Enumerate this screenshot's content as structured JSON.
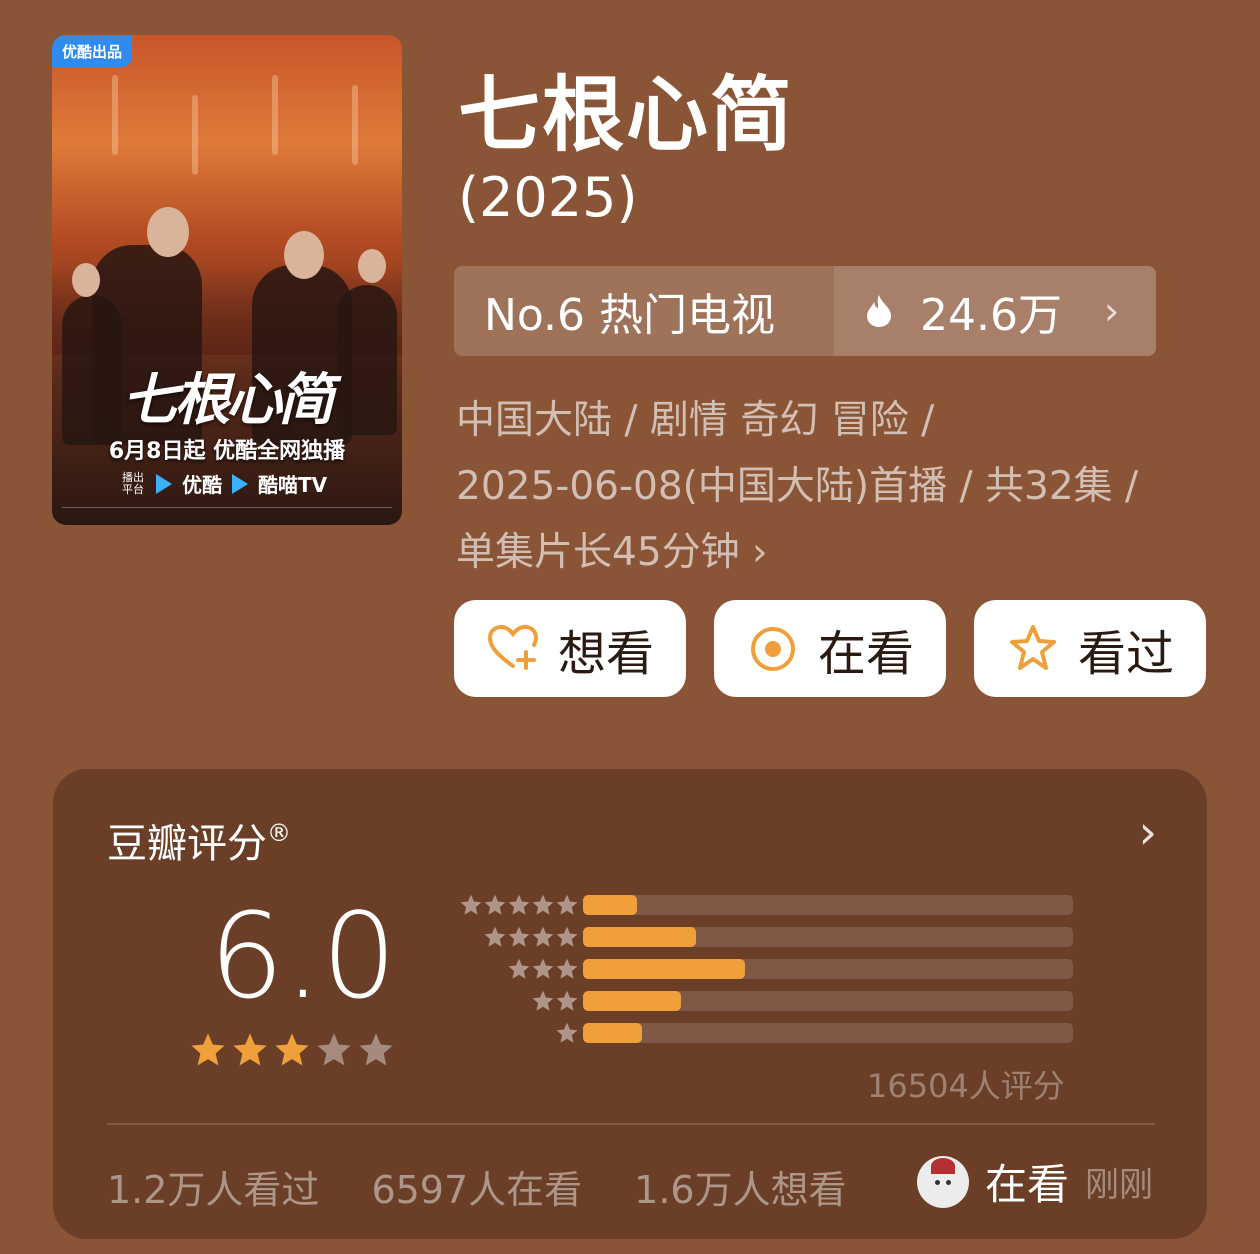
{
  "poster": {
    "badge": "优酷出品",
    "calligraphy": "七根心简",
    "release_line": "6月8日起 优酷全网独播",
    "platform_label": "播出平台",
    "platform_1": "优酷",
    "platform_2": "酷喵TV"
  },
  "title": "七根心简",
  "year": "(2025)",
  "rank": {
    "label": "No.6 热门电视",
    "heat": "24.6万",
    "chevron": "›"
  },
  "meta": {
    "line1": "中国大陆 / 剧情 奇幻 冒险 /",
    "line2": "2025-06-08(中国大陆)首播 / 共32集 /",
    "line3": "单集片长45分钟 ›"
  },
  "actions": {
    "want": "想看",
    "watching": "在看",
    "watched": "看过"
  },
  "rating": {
    "title": "豆瓣评分",
    "registered": "®",
    "chevron": "›",
    "score": "6.0",
    "star_level": 3,
    "distribution": [
      {
        "stars": 5,
        "percent": 11
      },
      {
        "stars": 4,
        "percent": 23
      },
      {
        "stars": 3,
        "percent": 33
      },
      {
        "stars": 2,
        "percent": 20
      },
      {
        "stars": 1,
        "percent": 12
      }
    ],
    "raters": "16504人评分",
    "stats": {
      "watched": "1.2万人看过",
      "watching": "6597人在看",
      "want": "1.6万人想看"
    },
    "activity": {
      "action": "在看",
      "time": "刚刚"
    }
  },
  "colors": {
    "background": "#8a5436",
    "card": "#6a3e27",
    "accent": "#f0a03a",
    "button_icon": "#f0a03a"
  }
}
